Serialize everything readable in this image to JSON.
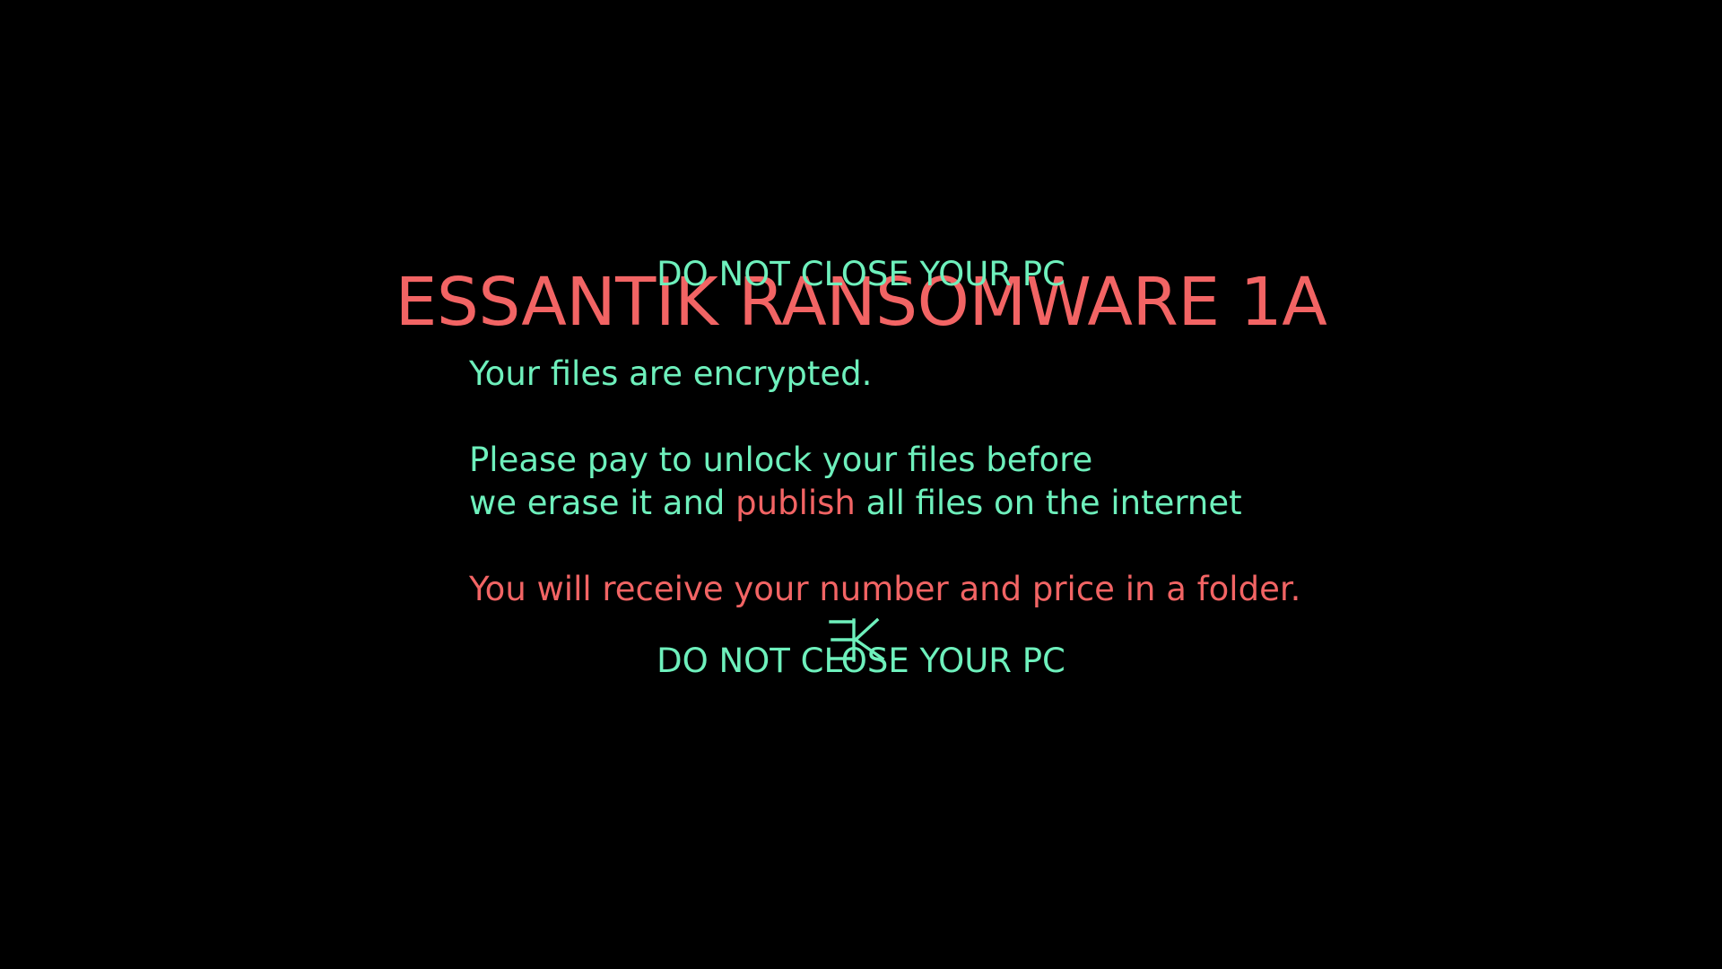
{
  "window": {
    "background": "#000000"
  },
  "colors": {
    "accent_mint": "#6ef0bc",
    "accent_coral": "#f26464"
  },
  "header": {
    "warning_top": "DO NOT CLOSE YOUR PC",
    "title": "ESSANTIK RANSOMWARE 1A"
  },
  "message": {
    "line1": "Your files are encrypted.",
    "line2": "Please pay to unlock your files before",
    "line3_before": "we erase it and ",
    "line3_highlight": "publish",
    "line3_after": " all files on the internet",
    "line4": "You will receive your number and price in a folder."
  },
  "footer": {
    "logo_icon": "ek-logo-icon",
    "warning_bottom": "DO NOT CLOSE YOUR PC"
  }
}
